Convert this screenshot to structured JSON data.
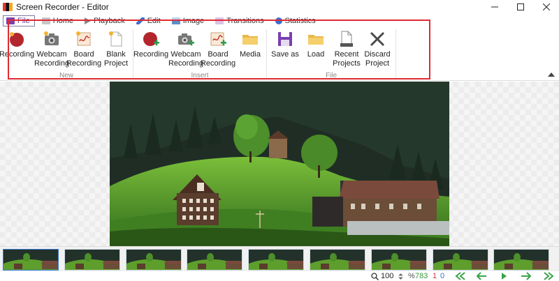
{
  "window": {
    "title": "Screen Recorder - Editor"
  },
  "tabs": [
    {
      "label": "File",
      "active": true
    },
    {
      "label": "Home"
    },
    {
      "label": "Playback"
    },
    {
      "label": "Edit"
    },
    {
      "label": "Image"
    },
    {
      "label": "Transitions"
    },
    {
      "label": "Statistics"
    }
  ],
  "ribbon": {
    "groups": [
      {
        "label": "New",
        "buttons": [
          {
            "label_lines": [
              "Recording"
            ],
            "icon": "record-new-icon"
          },
          {
            "label_lines": [
              "Webcam",
              "Recording"
            ],
            "icon": "webcam-new-icon"
          },
          {
            "label_lines": [
              "Board",
              "Recording"
            ],
            "icon": "board-new-icon"
          },
          {
            "label_lines": [
              "Blank",
              "Project"
            ],
            "icon": "blank-project-icon"
          }
        ]
      },
      {
        "label": "Insert",
        "buttons": [
          {
            "label_lines": [
              "Recording"
            ],
            "icon": "record-insert-icon"
          },
          {
            "label_lines": [
              "Webcam",
              "Recording"
            ],
            "icon": "webcam-insert-icon"
          },
          {
            "label_lines": [
              "Board",
              "Recording"
            ],
            "icon": "board-insert-icon"
          },
          {
            "label_lines": [
              "Media"
            ],
            "icon": "media-folder-icon"
          }
        ]
      },
      {
        "label": "File",
        "buttons": [
          {
            "label_lines": [
              "Save as"
            ],
            "icon": "save-icon"
          },
          {
            "label_lines": [
              "Load"
            ],
            "icon": "load-folder-icon"
          },
          {
            "label_lines": [
              "Recent",
              "Projects"
            ],
            "icon": "recent-projects-icon"
          },
          {
            "label_lines": [
              "Discard",
              "Project"
            ],
            "icon": "discard-icon"
          }
        ]
      }
    ]
  },
  "filmstrip": {
    "frame_count_visible": 9,
    "selected_index": 0
  },
  "status": {
    "zoom": "100",
    "percent_symbol": "%",
    "frame_total": "783",
    "selected_count": "1",
    "current_frame": "0"
  },
  "colors": {
    "annotation_border": "#e02a33",
    "active_tab_text": "#6a3fa0",
    "frame_total": "#3a9a3a",
    "selected_count": "#d9323a",
    "current_frame": "#2a6fd6",
    "nav_arrow": "#3aa24a"
  }
}
